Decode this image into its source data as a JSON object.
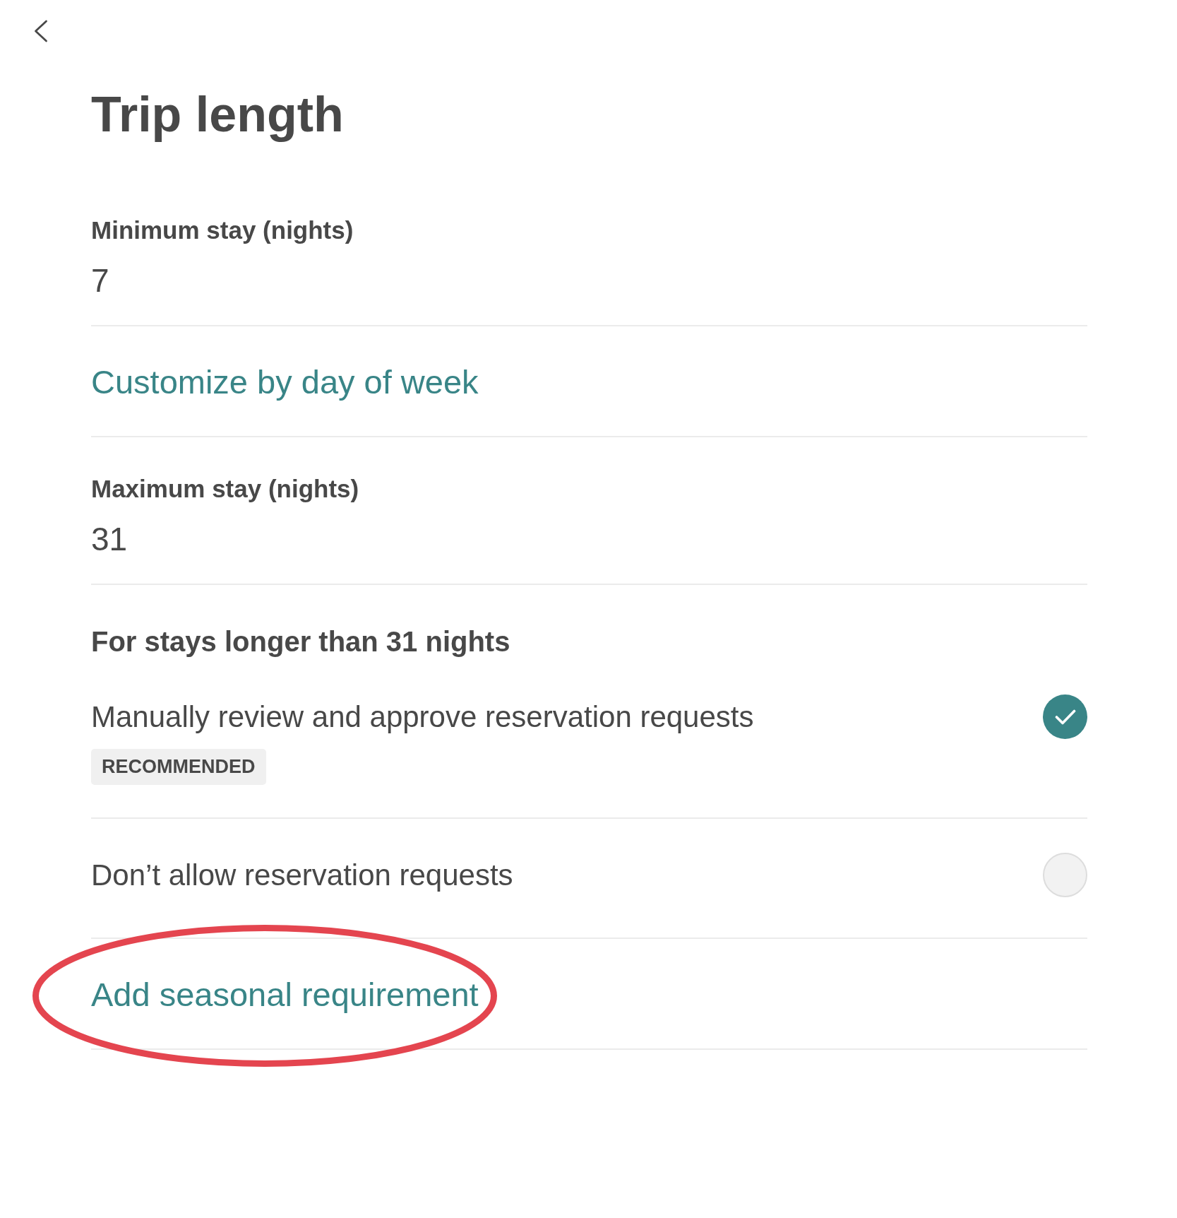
{
  "title": "Trip length",
  "sections": [
    {
      "kind": "field",
      "label": "Minimum stay (nights)",
      "value": "7"
    },
    {
      "kind": "link",
      "text": "Customize by day of week",
      "circled": false
    },
    {
      "kind": "field",
      "label": "Maximum stay (nights)",
      "value": "31"
    },
    {
      "kind": "options",
      "heading": "For stays longer than 31 nights",
      "options": [
        {
          "label": "Manually review and approve reservation requests",
          "badge": "RECOMMENDED",
          "selected": true
        },
        {
          "label": "Don’t allow reservation requests",
          "selected": false
        }
      ]
    },
    {
      "kind": "link",
      "text": "Add seasonal requirement",
      "circled": true
    }
  ]
}
